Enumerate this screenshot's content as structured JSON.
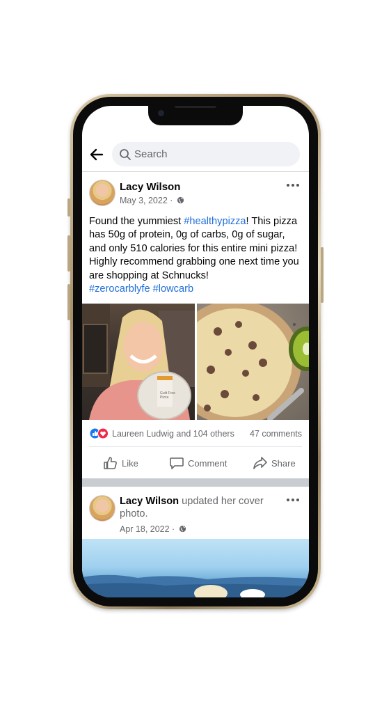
{
  "header": {
    "search_placeholder": "Search"
  },
  "post": {
    "author": "Lacy Wilson",
    "date": "May 3, 2022 ·",
    "text_parts": {
      "p1": "Found the yummiest ",
      "tag1": "#healthypizza",
      "p2": "! This pizza has 50g of protein, 0g of carbs, 0g of sugar, and only 510 calories for this entire mini pizza! Highly recommend grabbing one next time you are shopping at Schnucks!",
      "tag2": "#zerocarblyfe",
      "tag3": "#lowcarb"
    },
    "photo_left_label": "Guilt Free Pizza",
    "reactions_text": "Laureen Ludwig and 104 others",
    "comments_text": "47 comments",
    "actions": {
      "like": "Like",
      "comment": "Comment",
      "share": "Share"
    }
  },
  "post2": {
    "author": "Lacy Wilson",
    "action_text": " updated her cover",
    "action_text2": "photo.",
    "date": "Apr 18, 2022 ·"
  },
  "colors": {
    "link": "#216fdb",
    "text": "#050505",
    "secondary": "#65676b",
    "separator": "#c9ccd1"
  },
  "icons": [
    "back-arrow-icon",
    "search-icon",
    "globe-icon",
    "more-icon",
    "like-reaction-icon",
    "love-reaction-icon",
    "like-icon",
    "comment-icon",
    "share-icon"
  ]
}
